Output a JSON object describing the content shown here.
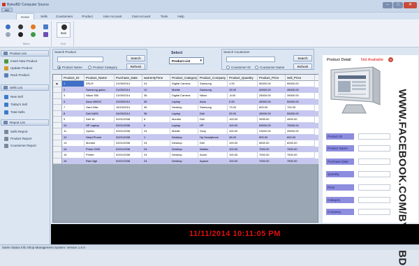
{
  "window": {
    "title": "BytesBD Computer Source",
    "qat_label": "NO"
  },
  "tabs": [
    {
      "label": "Home",
      "active": true
    },
    {
      "label": "Sells"
    },
    {
      "label": "Coustomers"
    },
    {
      "label": "Product"
    },
    {
      "label": "User Account"
    },
    {
      "label": "Cast Account"
    },
    {
      "label": "Tools"
    },
    {
      "label": "Help"
    }
  ],
  "ribbon": {
    "group1_label": "Skins",
    "exit_label": "Exit",
    "group2_label": "Exit"
  },
  "sidebar": {
    "sections": [
      {
        "title": "Product List",
        "items": [
          "Insert New Product",
          "Update Product",
          "Rack Product"
        ]
      },
      {
        "title": "Sells List",
        "items": [
          "New Sell",
          "Today's Sell",
          "Total Sells"
        ]
      },
      {
        "title": "Report List",
        "items": [
          "Sells Report",
          "Product Report",
          "Coustomer Report"
        ]
      }
    ]
  },
  "search_product": {
    "label": "Search Product",
    "search_button": "Search",
    "refresh_button": "Refresh",
    "option_name": "Product Name",
    "option_category": "Product Category"
  },
  "select": {
    "label": "Select",
    "value": "Product List"
  },
  "search_customer": {
    "label": "Search Coustomer",
    "search_button": "Search",
    "refresh_button": "Refresh",
    "option_id": "Coustomer ID",
    "option_name": "Coustomer Name"
  },
  "table": {
    "columns": [
      "Product_ID",
      "Product_Name",
      "Purchase_Date",
      "warrentyTime",
      "Product_Category",
      "Product_Company",
      "Product_Quantity",
      "Product_Price",
      "Sell_Price"
    ],
    "rows": [
      [
        "1",
        "DSLR",
        "21/09/2014",
        "24",
        "Digital Camera",
        "Samsung",
        "1.00",
        "50000.00",
        "55000.00"
      ],
      [
        "2",
        "Samsung galax...",
        "21/09/2014",
        "12",
        "Mobile",
        "Samsung",
        "15.00",
        "40000.00",
        "45000.00"
      ],
      [
        "3",
        "Nikon 550",
        "21/09/2014",
        "36",
        "Digital Camera",
        "Nikon",
        "-8.00",
        "25000.00",
        "26000.00"
      ],
      [
        "4",
        "Asus N5000",
        "22/09/2014",
        "36",
        "Laptop",
        "Asus",
        "0.00",
        "45000.00",
        "50000.00"
      ],
      [
        "7",
        "Hard Disk",
        "15/10/2014",
        "36",
        "Desktop",
        "Samsung",
        "73.00",
        "600.00",
        "700.00"
      ],
      [
        "8",
        "Dell N405",
        "04/09/2014",
        "36",
        "Laptop",
        "Dell",
        "25.00",
        "45000.00",
        "50000.00"
      ],
      [
        "9",
        "Dell 16",
        "02/01/2008",
        "6",
        "Monitor",
        "Dell",
        "100.00",
        "3999.00",
        "4500.00"
      ],
      [
        "10",
        "HP Laptop",
        "02/01/2008",
        "6",
        "Laptop",
        "HP",
        "100.00",
        "69000.00",
        "75000.00"
      ],
      [
        "11",
        "Xperia",
        "02/01/2008",
        "24",
        "Mobile",
        "Sony",
        "100.00",
        "23000.00",
        "25000.00"
      ],
      [
        "12",
        "Head Phone",
        "02/01/2008",
        "1",
        "Desktop",
        "Hp Headphone",
        "46.00",
        "500.00",
        "600.00"
      ],
      [
        "13",
        "Monitor",
        "02/01/2008",
        "24",
        "Desktop",
        "Dell",
        "100.00",
        "5500.00",
        "6000.00"
      ],
      [
        "14",
        "Prime GHD",
        "02/01/2008",
        "24",
        "Desktop",
        "Walton",
        "100.00",
        "7000.00",
        "7500.00"
      ],
      [
        "15",
        "Printer",
        "02/01/2008",
        "24",
        "Desktop",
        "Aocer",
        "100.00",
        "7000.00",
        "7500.00"
      ],
      [
        "16",
        "Ram 8gb",
        "02/01/2008",
        "24",
        "Desktop",
        "Apacer",
        "100.00",
        "7000.00",
        "7500.00"
      ]
    ]
  },
  "detail": {
    "title": "Product Detail",
    "status": "Not Available",
    "fields": [
      "Product ID",
      "Product Name",
      "Purchase Date",
      "Quantity",
      "Price",
      "Category",
      "Company"
    ]
  },
  "watermark": "WWW.FACEBOOK.COM/BYTESBD",
  "clock": "11/11/2014 10:11:05 PM",
  "status": {
    "text": "Same Status Info   Shop Management System: Version 1.5.0"
  },
  "colors": {
    "row_stripe": "#c6c6f1",
    "label_bg": "#8d8ddf",
    "clock": "#e01010"
  }
}
